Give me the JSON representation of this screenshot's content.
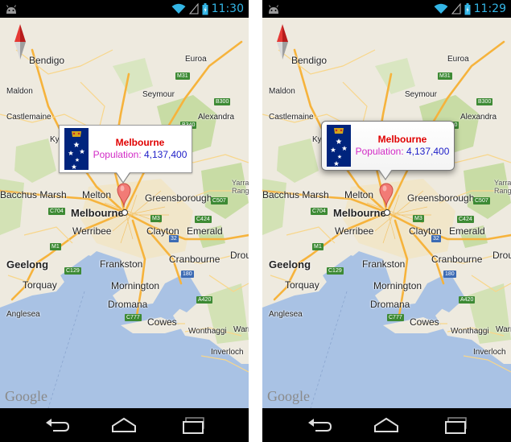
{
  "screens": [
    {
      "status": {
        "time": "11:30"
      },
      "infowindow": {
        "title": "Melbourne",
        "population_label": "Population:",
        "population_value": "4,137,400",
        "style": "flat"
      }
    },
    {
      "status": {
        "time": "11:29"
      },
      "infowindow": {
        "title": "Melbourne",
        "population_label": "Population:",
        "population_value": "4,137,400",
        "style": "rounded-shadow"
      }
    }
  ],
  "map": {
    "labels": {
      "bendigo": "Bendigo",
      "euroa": "Euroa",
      "maldon": "Maldon",
      "seymour": "Seymour",
      "castlemaine": "Castlemaine",
      "alexandra": "Alexandra",
      "kyneton": "Ky",
      "yarra_ranges": "Yarra\nRanges",
      "bacchus_marsh": "Bacchus Marsh",
      "melton": "Melton",
      "greensborough": "Greensborough",
      "melbourne": "Melbourne",
      "werribee": "Werribee",
      "clayton": "Clayton",
      "emerald": "Emerald",
      "geelong": "Geelong",
      "frankston": "Frankston",
      "cranbourne": "Cranbourne",
      "torquay": "Torquay",
      "mornington": "Mornington",
      "dromana": "Dromana",
      "anglesea": "Anglesea",
      "cowes": "Cowes",
      "wonthaggi": "Wonthaggi",
      "inverloch": "Inverloch",
      "warrag": "Warra",
      "drouin": "Drouin"
    },
    "shields": {
      "m31": "M31",
      "b300": "B300",
      "b340": "B340",
      "c704": "C704",
      "m3": "M3",
      "c424": "C424",
      "c507": "C507",
      "m1": "M1",
      "c129": "C129",
      "r32": "32",
      "r180": "180",
      "a420": "A420",
      "c777": "C777"
    },
    "attribution": "Google"
  },
  "icons": {
    "android": "android-debug-icon",
    "wifi": "wifi-icon",
    "signal": "signal-icon",
    "battery": "battery-charging-icon",
    "compass": "compass-icon",
    "marker": "map-marker-icon",
    "back": "back-icon",
    "home": "home-icon",
    "recents": "recent-apps-icon"
  },
  "colors": {
    "clock": "#33b5e5",
    "title": "#e00000",
    "population_label": "#d22ac6",
    "population_value": "#2020c8",
    "water": "#a9c2e4",
    "highway": "#f6b33c",
    "park": "#c8dca5"
  }
}
